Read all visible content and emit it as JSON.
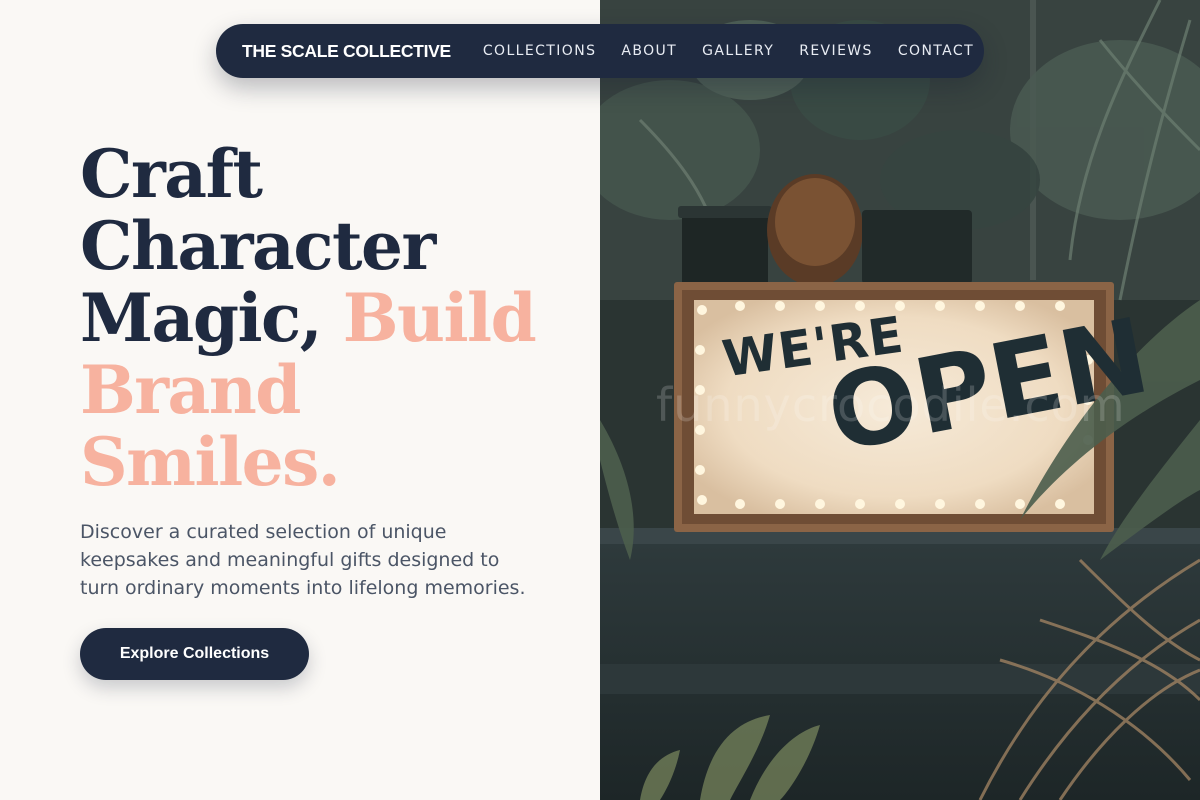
{
  "brand": {
    "name": "THE SCALE COLLECTIVE"
  },
  "nav": {
    "items": [
      {
        "label": "COLLECTIONS"
      },
      {
        "label": "ABOUT"
      },
      {
        "label": "GALLERY"
      },
      {
        "label": "REVIEWS"
      },
      {
        "label": "CONTACT"
      }
    ]
  },
  "hero": {
    "headline": {
      "line1": "Craft",
      "line2": "Character",
      "line3_dark": "Magic,",
      "line3_accent": "Build",
      "line4": "Brand",
      "line5": "Smiles."
    },
    "subtitle": "Discover a curated selection of unique keepsakes and meaningful gifts designed to turn ordinary moments into lifelong memories.",
    "cta_label": "Explore Collections"
  },
  "photo": {
    "sign_line1": "WE'RE",
    "sign_line2": "OPEN",
    "watermark": "funnycrocodile.com"
  },
  "colors": {
    "navy": "#1f2a40",
    "accent": "#f7b29f",
    "background": "#faf8f5",
    "body_text": "#4b5566"
  }
}
